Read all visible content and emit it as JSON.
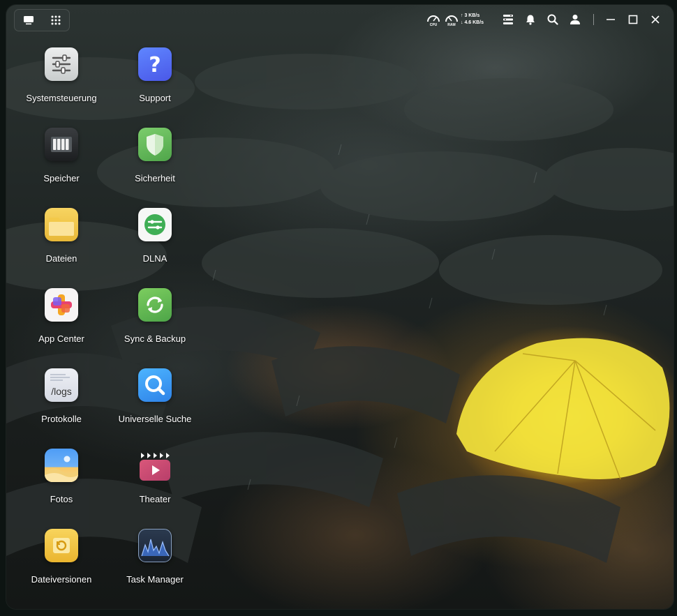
{
  "topbar": {
    "cpu_label": "CPU",
    "ram_label": "RAM",
    "upload": "3 KB/s",
    "download": "4.6 KB/s"
  },
  "apps": [
    {
      "label": "Systemsteuerung"
    },
    {
      "label": "Support"
    },
    {
      "label": "Speicher"
    },
    {
      "label": "Sicherheit"
    },
    {
      "label": "Dateien"
    },
    {
      "label": "DLNA"
    },
    {
      "label": "App Center"
    },
    {
      "label": "Sync & Backup"
    },
    {
      "label": "Protokolle",
      "icon_text": "/logs"
    },
    {
      "label": "Universelle Suche"
    },
    {
      "label": "Fotos"
    },
    {
      "label": "Theater"
    },
    {
      "label": "Dateiversionen"
    },
    {
      "label": "Task Manager"
    }
  ],
  "colors": {
    "accent_yellow": "#f3e13a",
    "security_green": "#5fb85a",
    "support_blue": "#4f6ff0"
  }
}
